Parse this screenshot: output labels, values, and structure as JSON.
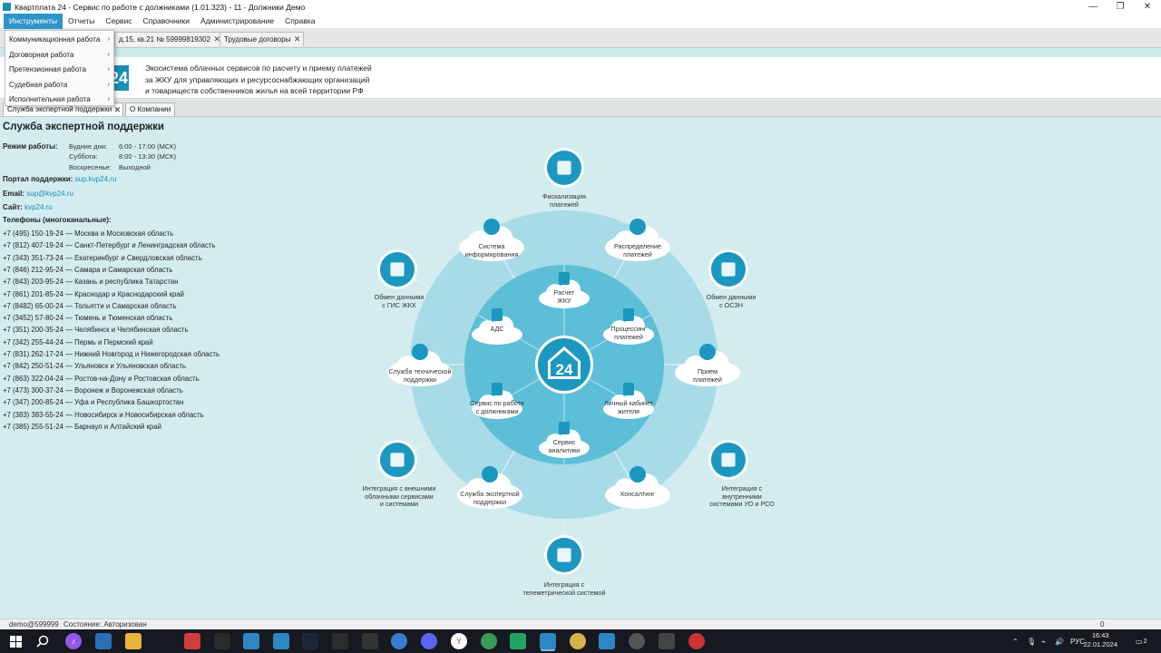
{
  "window": {
    "title": "Квартплата 24 - Сервис по работе с должниками (1.01.323) - 11 - Должники Демо",
    "controls": [
      "—",
      "❐",
      "✕"
    ]
  },
  "menu": {
    "items": [
      "Инструменты",
      "Отчеты",
      "Сервис",
      "Справочники",
      "Администрирование",
      "Справка"
    ]
  },
  "dropdown": {
    "items": [
      "Коммуникационная работа",
      "Договорная работа",
      "Претензионная работа",
      "Судебная работа",
      "Исполнительная работа"
    ],
    "arrow": "›"
  },
  "tabs": {
    "account": "д.15, кв.21 № 59999819302",
    "contracts": "Трудовые договоры",
    "close": "✕"
  },
  "banner": {
    "logo": "24",
    "line1": "Экосистема облачных сервисов по расчету и приему платежей",
    "line2": "за ЖКУ для управляющих и ресурсоснабжающих организаций",
    "line3": "и товариществ собственников жилья на всей территории РФ"
  },
  "subtabs": {
    "support": "Служба экспертной поддержки",
    "about": "О Компании"
  },
  "support": {
    "title": "Служба экспертной поддержки",
    "hours_label": "Режим работы:",
    "schedule": [
      {
        "day": "Будние дни:",
        "time": "6:00 - 17:00 (МСК)"
      },
      {
        "day": "Суббота:",
        "time": "8:00 - 13:30 (МСК)"
      },
      {
        "day": "Воскресенье:",
        "time": "Выходной"
      }
    ],
    "portal_label": "Портал поддержки:",
    "portal": "sup.kvp24.ru",
    "email_label": "Email:",
    "email": "sup@kvp24.ru",
    "site_label": "Сайт:",
    "site": "kvp24.ru",
    "phones_label": "Телефоны (многоканальные):",
    "phones": [
      "+7 (495) 150-19-24 — Москва и Московская область",
      "+7 (812) 407-19-24 — Санкт-Петербург и Ленинградская область",
      "+7 (343) 351-73-24 — Екатеринбург и Свердловская область",
      "+7 (846) 212-95-24 — Самара и Самарская область",
      "+7 (843) 203-95-24 — Казань и республика Татарстан",
      "+7 (861) 201-85-24 — Краснодар и Краснодарский край",
      "+7 (8482) 65-00-24 — Тольятти и Самарская область",
      "+7 (3452) 57-80-24 — Тюмень и Тюменская область",
      "+7 (351) 200-35-24 — Челябинск и Челябинская область",
      "+7 (342) 255-44-24 — Пермь и Пермский край",
      "+7 (831) 262-17-24 — Нижний Новгород и Нижегородская область",
      "+7 (842) 250-51-24 — Ульяновск и Ульяновская область",
      "+7 (863) 322-04-24 — Ростов-на-Дону и Ростовская область",
      "+7 (473) 300-37-24 — Воронеж и Воронежская область",
      "+7 (347) 200-85-24 — Уфа и Республика Башкортостан",
      "+7 (383) 383-55-24 — Новосибирск и Новосибирская область",
      "+7 (385) 255-51-24 — Барнаул и Алтайский край"
    ]
  },
  "diagram": {
    "center": "24",
    "inner": [
      "Расчет\nЖКУ",
      "Процессинг\nплатежей",
      "Личный кабинет\nжителя",
      "Сервис\nаналитики",
      "Сервис по работе\nс должниками",
      "АДС"
    ],
    "middle": [
      "Система\nинформирования",
      "Распределение\nплатежей",
      "Прием\nплатежей",
      "Консалтинг",
      "Служба экспертной\nподдержки",
      "Служба технической\nподдержки"
    ],
    "outer": [
      "Фискализация\nплатежей",
      "Обмен данными\nс ОСЗН",
      "Интеграция с\nвнутренними\nсистемами УО и РСО",
      "Интеграция с\nтелеметрической системой",
      "Интеграция с внешними\nоблачными сервисами\nи системами",
      "Обмен данными\nс ГИС ЖКХ"
    ],
    "colors": {
      "dark": "#1b97c0",
      "mid": "#5cbfd7",
      "light": "#a7dbe7",
      "pale": "#cbe9f0"
    }
  },
  "status": {
    "user": "demo@599999",
    "state": "Состояние: Авторизован",
    "count": "0"
  },
  "taskbar": {
    "lang": "РУС",
    "time": "16:43",
    "date": "22.01.2024",
    "notif": "2"
  }
}
